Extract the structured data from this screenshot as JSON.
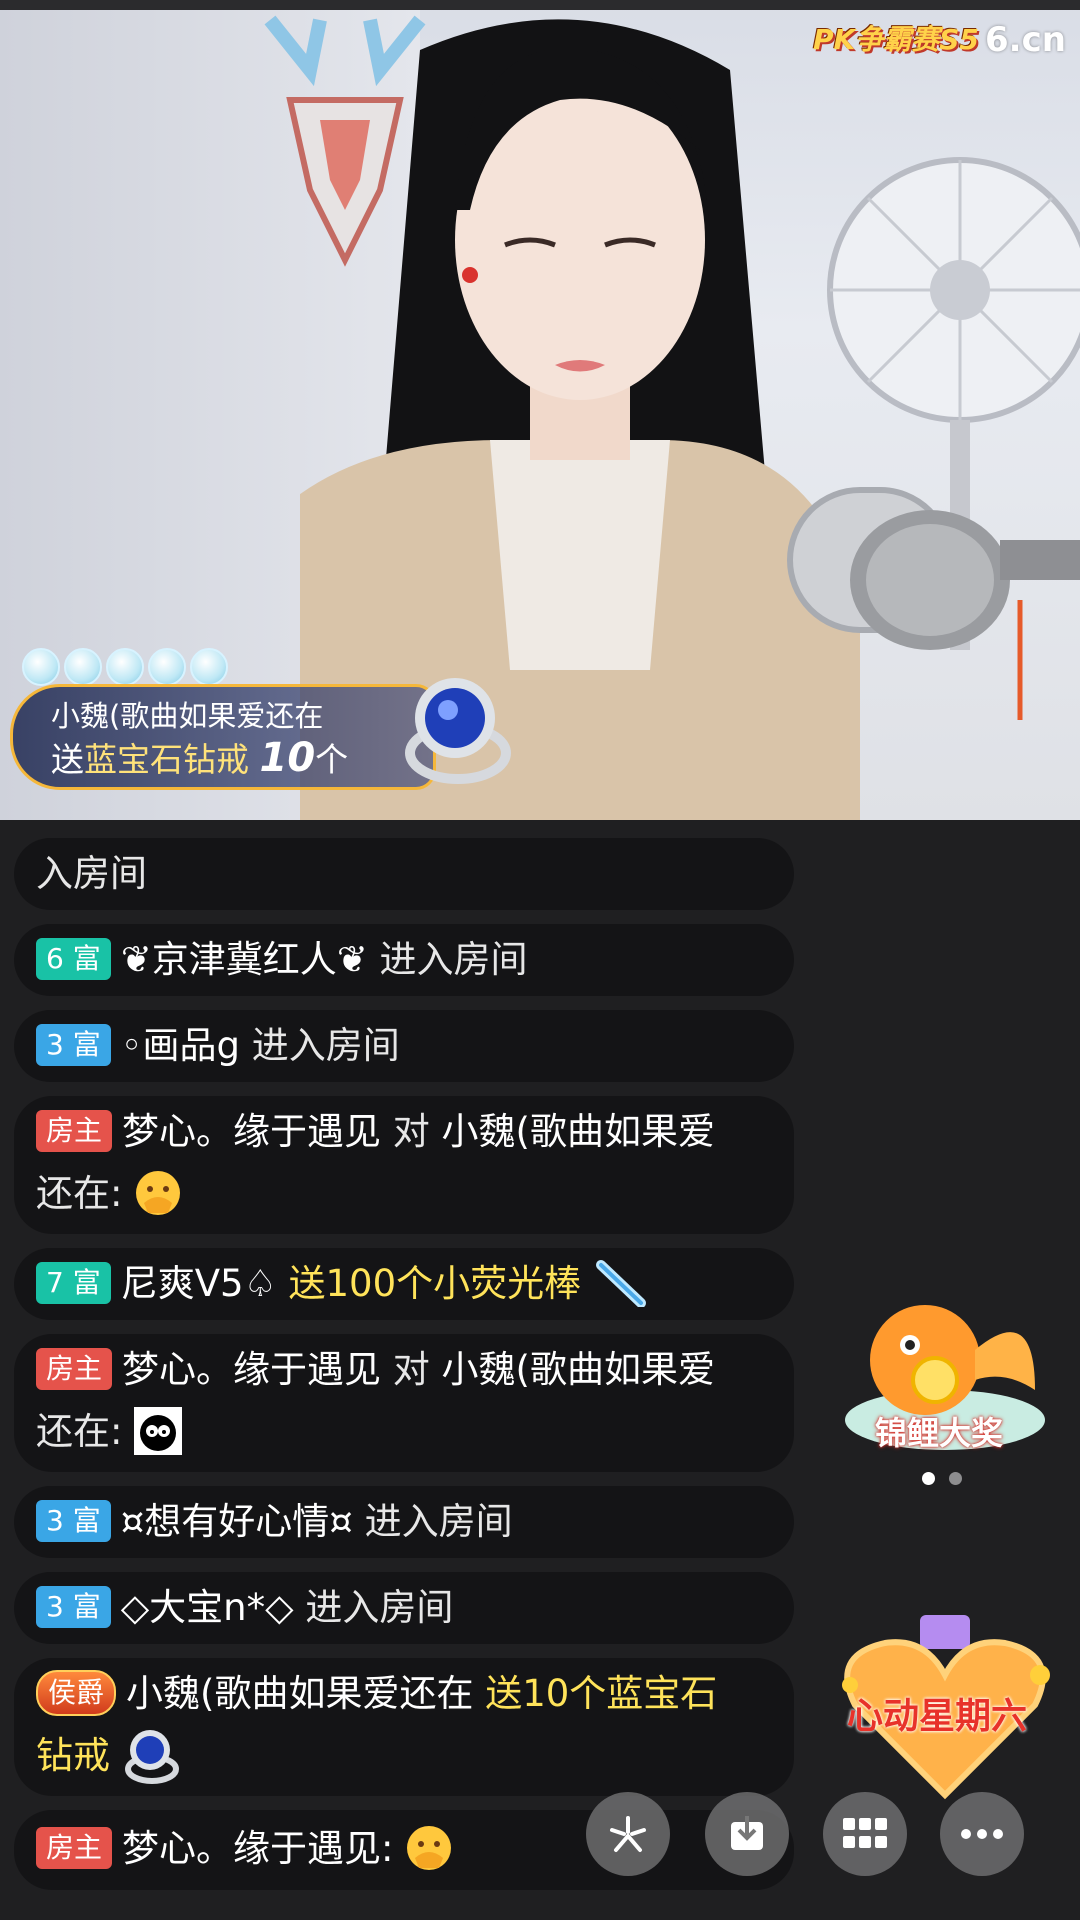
{
  "stream": {
    "pk_logo": "PK争霸赛S5",
    "site_logo": "6.cn"
  },
  "gift_banner": {
    "sender": "小魏(歌曲如果爱还在",
    "send_word": "送",
    "gift_name": "蓝宝石钻戒",
    "count": "10",
    "unit": "个"
  },
  "chat": {
    "messages": [
      {
        "badge": "",
        "user": "",
        "text": "入房间"
      },
      {
        "badge": "6 富",
        "user": "❦京津冀红人❦",
        "text": "进入房间"
      },
      {
        "badge": "3 富",
        "user": "◦画品g",
        "text": "进入房间"
      },
      {
        "badge": "房主",
        "user": "梦心。缘于遇见",
        "to": "对",
        "target": "小魏(歌曲如果爱",
        "cont": "还在:"
      },
      {
        "badge": "7 富",
        "user": "尼爽V5♤",
        "gift": "送100个小荧光棒"
      },
      {
        "badge": "房主",
        "user": "梦心。缘于遇见",
        "to": "对",
        "target": "小魏(歌曲如果爱",
        "cont": "还在:"
      },
      {
        "badge": "3 富",
        "user": "¤想有好心情¤",
        "text": "进入房间"
      },
      {
        "badge": "3 富",
        "user": "◇大宝n*◇",
        "text": "进入房间"
      },
      {
        "badge": "侯爵",
        "user": "小魏(歌曲如果爱还在",
        "gift": "送10个蓝宝石",
        "cont": "钻戒"
      },
      {
        "badge": "房主",
        "user": "梦心。缘于遇见:"
      }
    ]
  },
  "promos": {
    "koi": "锦鲤大奖",
    "heart": "心动星期六"
  },
  "controls": {
    "sparkle_icon": "sparkle-icon",
    "download_icon": "download-icon",
    "grid_icon": "grid-icon",
    "more_icon": "more-icon"
  },
  "colors": {
    "rich_high": "#19c2a6",
    "rich_low": "#3aa6e6",
    "owner": "#e5534b",
    "gift_text": "#ffe35a"
  }
}
